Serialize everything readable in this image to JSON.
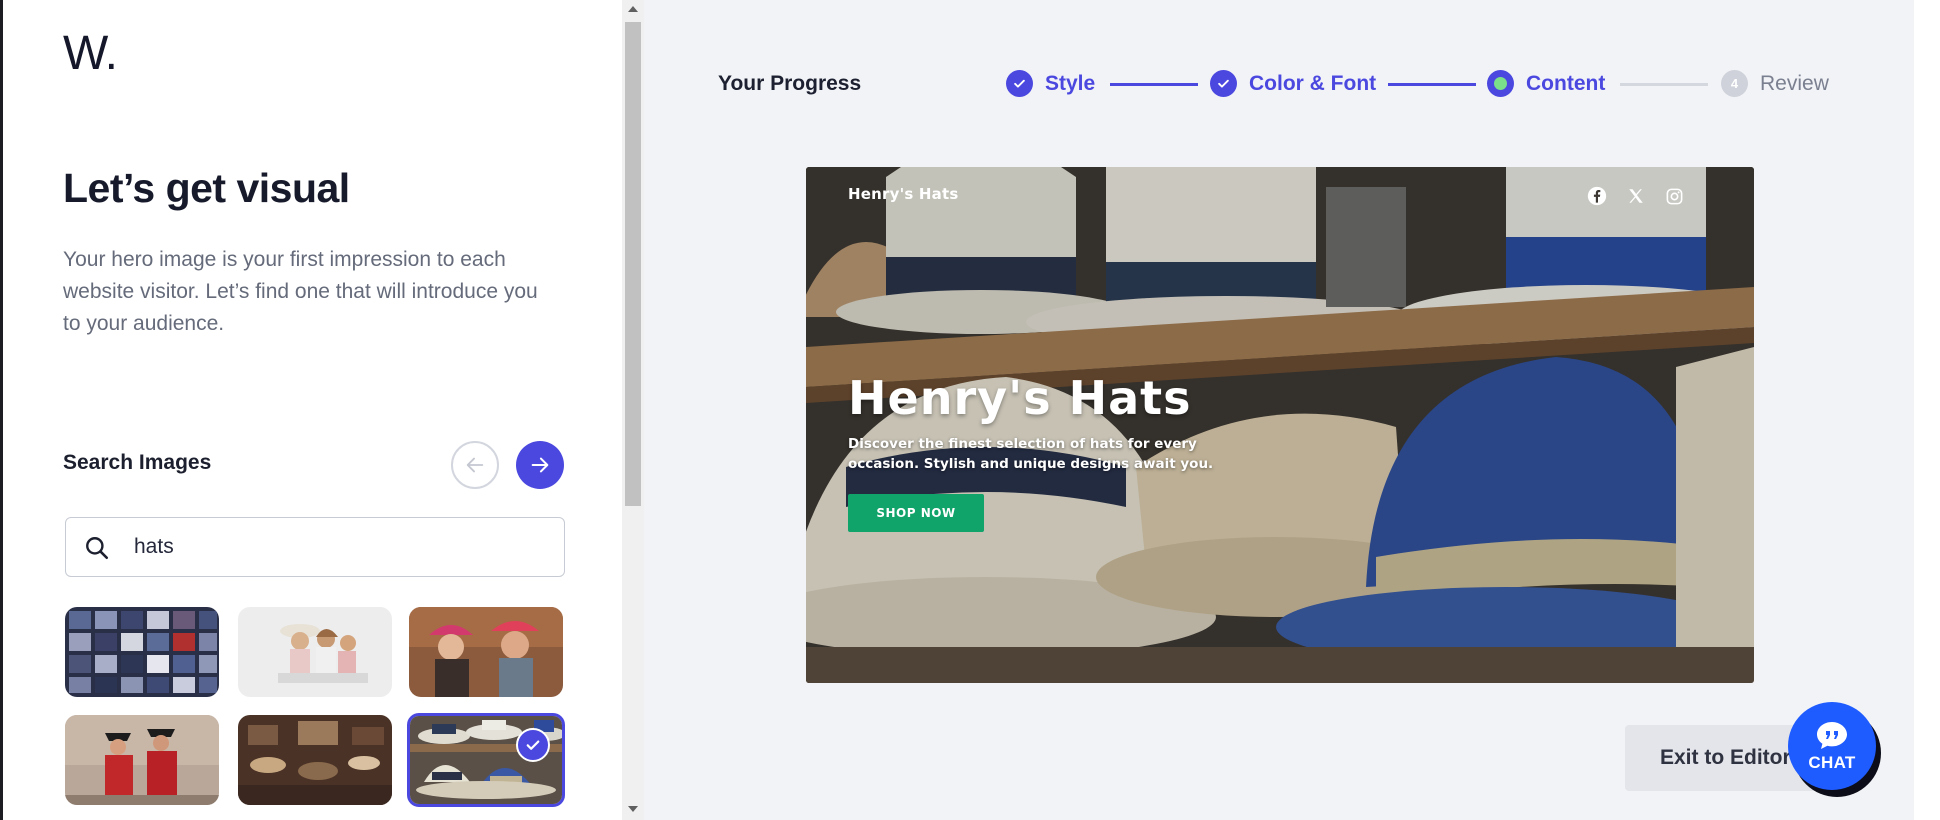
{
  "brand": {
    "logo": "W."
  },
  "left": {
    "heading": "Let’s get visual",
    "intro": "Your hero image is your first impression to each website visitor. Let’s find one that will introduce you to your audience.",
    "search_title": "Search Images",
    "search_value": "hats",
    "thumbnails": [
      {
        "subject": "wall-of-patches"
      },
      {
        "subject": "women-in-hats"
      },
      {
        "subject": "smiling-women-in-caps"
      },
      {
        "subject": "performers-in-red-costumes"
      },
      {
        "subject": "antique-shop-hats"
      },
      {
        "subject": "hats-on-shelf",
        "selected": true
      }
    ]
  },
  "progress": {
    "label": "Your Progress",
    "steps": [
      {
        "label": "Style",
        "state": "done"
      },
      {
        "label": "Color & Font",
        "state": "done"
      },
      {
        "label": "Content",
        "state": "active"
      },
      {
        "number": "4",
        "label": "Review",
        "state": "pending"
      }
    ]
  },
  "preview": {
    "brand": "Henry's Hats",
    "title": "Henry's Hats",
    "subtitle": "Discover the finest selection of hats for every occasion. Stylish and unique designs await you.",
    "cta": "SHOP NOW",
    "social_icons": [
      "facebook-icon",
      "x-icon",
      "instagram-icon"
    ]
  },
  "actions": {
    "exit": "Exit to Editor",
    "chat": "CHAT"
  },
  "colors": {
    "accent": "#4b48e0",
    "cta_green": "#10a36a",
    "chat_blue": "#1f5cff"
  }
}
